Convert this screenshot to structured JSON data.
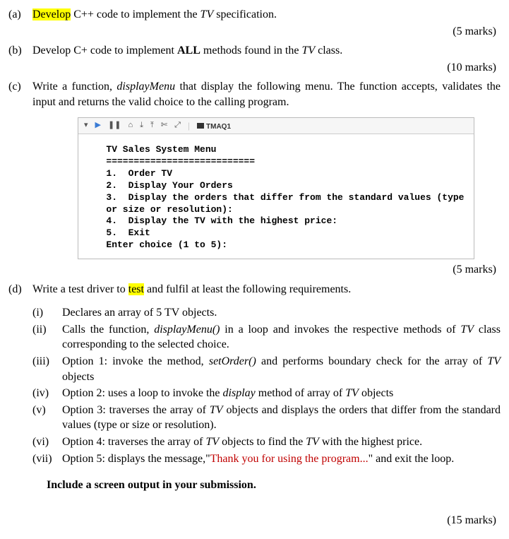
{
  "q_a": {
    "label": "(a)",
    "t1": "Develop",
    "t2": " C++ code to implement the ",
    "t3": "TV",
    "t4": " specification.",
    "marks": "(5 marks)"
  },
  "q_b": {
    "label": "(b)",
    "t1": "Develop C+ code to implement ",
    "t2": "ALL",
    "t3": " methods found in the ",
    "t4": "TV",
    "t5": " class.",
    "marks": "(10 marks)"
  },
  "q_c": {
    "label": "(c)",
    "t1": "Write a function, ",
    "t2": "displayMenu",
    "t3": " that display the following menu.  The function accepts, validates the input and returns the valid choice to the calling program.",
    "marks": "(5 marks)"
  },
  "console": {
    "tab": "TMAQ1",
    "body": "   TV Sales System Menu\n   ===========================\n   1.  Order TV\n   2.  Display Your Orders\n   3.  Display the orders that differ from the standard values (type\n   or size or resolution):\n   4.  Display the TV with the highest price:\n   5.  Exit\n   Enter choice (1 to 5):"
  },
  "q_d": {
    "label": "(d)",
    "t1": "Write a test driver to ",
    "t2": "test",
    "t3": " and fulfil at least the following requirements.",
    "marks": "(15 marks)"
  },
  "sub": {
    "i": {
      "label": "(i)",
      "t1": "Declares an array of 5 TV objects."
    },
    "ii": {
      "label": "(ii)",
      "t1": "Calls the function, ",
      "t2": "displayMenu()",
      "t3": " in a loop and invokes the respective methods of ",
      "t4": "TV",
      "t5": " class corresponding to the selected choice."
    },
    "iii": {
      "label": "(iii)",
      "t1": "Option 1: invoke the method, ",
      "t2": "setOrder()",
      "t3": " and performs boundary check for the array of ",
      "t4": "TV",
      "t5": " objects"
    },
    "iv": {
      "label": "(iv)",
      "t1": "Option 2: uses a loop to invoke the ",
      "t2": "display",
      "t3": " method of array of ",
      "t4": "TV",
      "t5": " objects"
    },
    "v": {
      "label": "(v)",
      "t1": "Option 3: traverses the array of ",
      "t2": "TV",
      "t3": " objects and displays the orders that differ from the standard values (type or size or resolution)."
    },
    "vi": {
      "label": "(vi)",
      "t1": "Option 4: traverses the array of ",
      "t2": "TV",
      "t3": " objects to find the ",
      "t4": "TV",
      "t5": " with the highest price."
    },
    "vii": {
      "label": "(vii)",
      "t1": "Option 5: displays the message,\"",
      "t2": "Thank you for using the program...",
      "t3": "\" and exit the loop."
    }
  },
  "include": "Include a screen output in your submission."
}
